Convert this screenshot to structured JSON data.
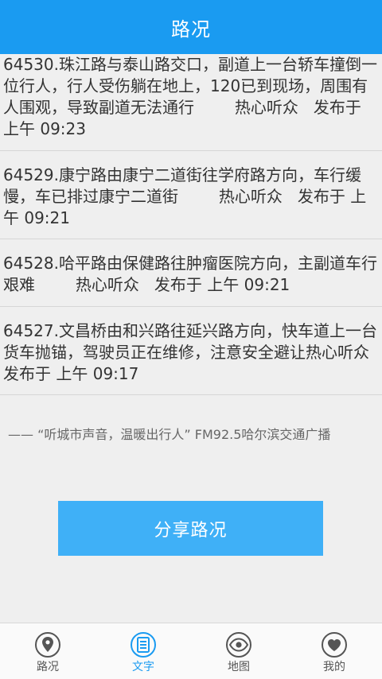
{
  "header": {
    "title": "路况"
  },
  "reports": [
    {
      "text": "64530.珠江路与泰山路交口，副道上一台轿车撞倒一位行人，行人受伤躺在地上，120已到现场，周围有人围观，导致副道无法通行",
      "meta": "        热心听众   发布于 上午 09:23"
    },
    {
      "text": "64529.康宁路由康宁二道街往学府路方向，车行缓慢，车已排过康宁二道街",
      "meta": "        热心听众   发布于 上午 09:21"
    },
    {
      "text": "64528.哈平路由保健路往肿瘤医院方向，主副道车行艰难",
      "meta": "        热心听众   发布于 上午 09:21"
    },
    {
      "text": "64527.文昌桥由和兴路往延兴路方向，快车道上一台货车抛锚，驾驶员正在维修，注意安全避让",
      "meta": "热心听众   发布于 上午 09:17"
    }
  ],
  "slogan": "—— “听城市声音，温暖出行人” FM92.5哈尔滨交通广播",
  "share_button": {
    "label": "分享路况"
  },
  "tabbar": {
    "items": [
      {
        "label": "路况",
        "icon": "location-pin-icon",
        "active": false
      },
      {
        "label": "文字",
        "icon": "document-icon",
        "active": true
      },
      {
        "label": "地图",
        "icon": "eye-icon",
        "active": false
      },
      {
        "label": "我的",
        "icon": "heart-icon",
        "active": false
      }
    ]
  },
  "colors": {
    "header_bg": "#1a9bf1",
    "button_bg": "#3fb0f7",
    "tab_active": "#1a9bf1",
    "tab_inactive": "#555555"
  }
}
